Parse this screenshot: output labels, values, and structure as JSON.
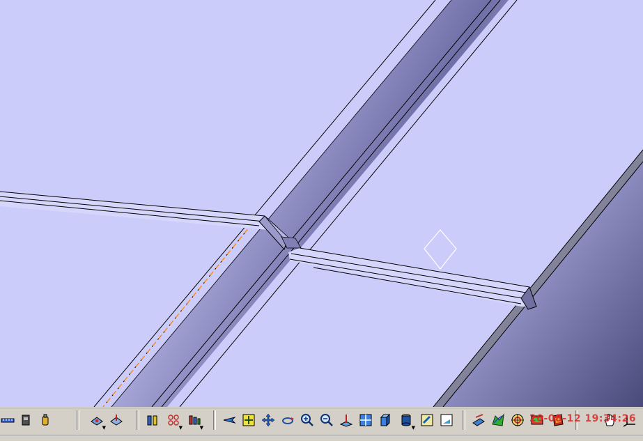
{
  "colors": {
    "background": "#ccccfa",
    "background_shadow": "#4a4a7a",
    "edge": "#000000",
    "highlight": "#ff8c1a",
    "toolbar": "#d4d0c8",
    "timestamp": "#dc2828"
  },
  "viewport": {
    "name": "3D model view",
    "selected_outline": "orange dashed"
  },
  "toolbar": {
    "buttons": [
      {
        "id": "measure",
        "icon": "measure-icon"
      },
      {
        "id": "apply-material",
        "icon": "apply-material-icon"
      },
      {
        "id": "macro",
        "icon": "macro-icon"
      },
      {
        "id": "snap",
        "icon": "snap-icon"
      },
      {
        "id": "compass",
        "icon": "compass-icon"
      },
      {
        "id": "parts",
        "icon": "parts-icon"
      },
      {
        "id": "grid",
        "icon": "grid-icon"
      },
      {
        "id": "constraint",
        "icon": "constraint-icon"
      },
      {
        "id": "fly",
        "icon": "fly-icon"
      },
      {
        "id": "fit-all",
        "icon": "fit-all-icon"
      },
      {
        "id": "pan",
        "icon": "pan-icon"
      },
      {
        "id": "rotate",
        "icon": "rotate-icon"
      },
      {
        "id": "zoom-in",
        "icon": "zoom-in-icon"
      },
      {
        "id": "zoom-out",
        "icon": "zoom-out-icon"
      },
      {
        "id": "normal-view",
        "icon": "normal-view-icon"
      },
      {
        "id": "multi-view",
        "icon": "multi-view-icon"
      },
      {
        "id": "iso-view",
        "icon": "iso-view-icon"
      },
      {
        "id": "shading",
        "icon": "shading-icon"
      },
      {
        "id": "hide-show",
        "icon": "hide-show-icon"
      },
      {
        "id": "swap-visible",
        "icon": "swap-visible-icon"
      },
      {
        "id": "sketch",
        "icon": "sketch-icon"
      },
      {
        "id": "analysis",
        "icon": "analysis-icon"
      },
      {
        "id": "target",
        "icon": "target-icon"
      },
      {
        "id": "render",
        "icon": "render-icon"
      },
      {
        "id": "material-library",
        "icon": "material-library-icon"
      },
      {
        "id": "hand",
        "icon": "hand-icon"
      },
      {
        "id": "axis",
        "icon": "axis-icon"
      }
    ]
  },
  "timestamp_overlay": "20-08-12 19:34:26"
}
